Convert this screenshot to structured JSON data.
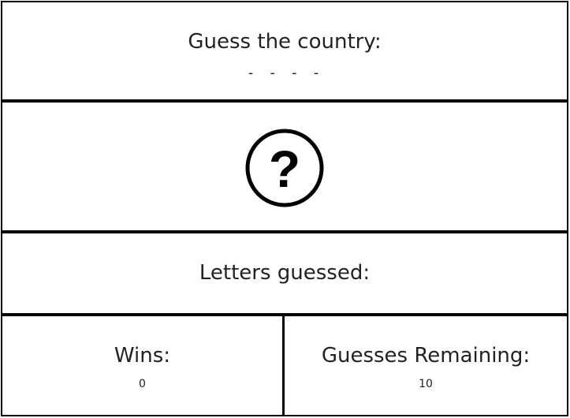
{
  "word": {
    "heading": "Guess the country:",
    "blanks": "- - - -"
  },
  "image": {
    "icon": "question-mark-circle-icon",
    "glyph": "?",
    "color": "#000000"
  },
  "letters": {
    "heading": "Letters guessed:",
    "guessed": ""
  },
  "stats": {
    "wins_label": "Wins:",
    "wins_value": "0",
    "guesses_label": "Guesses Remaining:",
    "guesses_value": "10"
  }
}
